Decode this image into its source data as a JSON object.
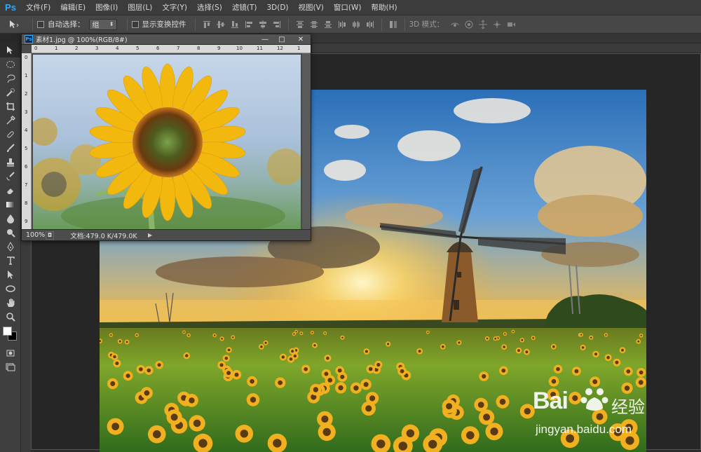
{
  "app": {
    "logo": "Ps"
  },
  "menu": [
    "文件(F)",
    "编辑(E)",
    "图像(I)",
    "图层(L)",
    "文字(Y)",
    "选择(S)",
    "滤镜(T)",
    "3D(D)",
    "视图(V)",
    "窗口(W)",
    "帮助(H)"
  ],
  "window_controls": {
    "minimize": "—",
    "maximize": "□",
    "close": "✕"
  },
  "options_bar": {
    "auto_select_label": "自动选择：",
    "auto_select_value": "组",
    "show_transform_label": "显示变换控件",
    "mode_3d_label": "3D 模式："
  },
  "document": {
    "title": "素材1.jpg @ 100%(RGB/8#)",
    "zoom": "100%",
    "doc_info": "文档:479.0 K/479.0K",
    "ruler_h": [
      "0",
      "1",
      "2",
      "3",
      "4",
      "5",
      "6",
      "7",
      "8",
      "9",
      "10",
      "11",
      "12",
      "1"
    ],
    "ruler_v": [
      "0",
      "1",
      "2",
      "3",
      "4",
      "5",
      "6",
      "7",
      "8",
      "9"
    ]
  },
  "watermark": {
    "brand": "Bai",
    "brand_cn": "经验",
    "url": "jingyan.baidu.com"
  },
  "colors": {
    "foreground": "#ffffff",
    "background": "#000000",
    "accent": "#31a8ff"
  },
  "icons": [
    "move-tool-icon",
    "marquee-icon",
    "lasso-icon",
    "quick-select-icon",
    "crop-icon",
    "eyedropper-icon",
    "healing-icon",
    "brush-icon",
    "stamp-icon",
    "history-brush-icon",
    "eraser-icon",
    "gradient-icon",
    "blur-icon",
    "dodge-icon",
    "pen-icon",
    "type-icon",
    "path-select-icon",
    "shape-icon",
    "hand-icon",
    "zoom-icon"
  ]
}
